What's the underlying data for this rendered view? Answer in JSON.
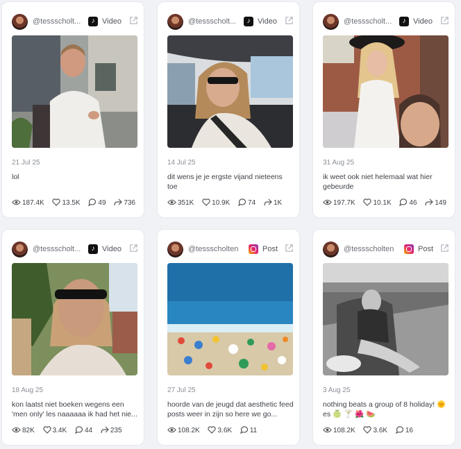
{
  "cards": [
    {
      "handle": "@tessscholt...",
      "platform": "tiktok",
      "type": "Video",
      "date": "21 Jul 25",
      "caption": "lol",
      "views": "187.4K",
      "likes": "13.5K",
      "comments": "49",
      "shares": "736"
    },
    {
      "handle": "@tessscholt...",
      "platform": "tiktok",
      "type": "Video",
      "date": "14 Jul 25",
      "caption": "dit wens je je ergste vijand nieteens toe",
      "views": "351K",
      "likes": "10.9K",
      "comments": "74",
      "shares": "1K"
    },
    {
      "handle": "@tessscholt...",
      "platform": "tiktok",
      "type": "Video",
      "date": "31 Aug 25",
      "caption": "ik weet ook niet helemaal wat hier gebeurde",
      "views": "197.7K",
      "likes": "10.1K",
      "comments": "46",
      "shares": "149"
    },
    {
      "handle": "@tessscholt...",
      "platform": "tiktok",
      "type": "Video",
      "date": "18 Aug 25",
      "caption": "kon laatst niet boeken wegens een 'men only' les naaaaaa ik had het nie...",
      "views": "82K",
      "likes": "3.4K",
      "comments": "44",
      "shares": "235"
    },
    {
      "handle": "@tessscholten",
      "platform": "instagram",
      "type": "Post",
      "date": "27 Jul 25",
      "caption": "hoorde van de jeugd dat aesthetic feed posts weer in zijn so here we go...",
      "views": "108.2K",
      "likes": "3.6K",
      "comments": "11",
      "shares": ""
    },
    {
      "handle": "@tessscholten",
      "platform": "instagram",
      "type": "Post",
      "date": "3 Aug 25",
      "caption": "nothing beats a group of 8 holiday! 🌞 es 🍈 🍸 🌺 🍉",
      "views": "108.2K",
      "likes": "3.6K",
      "comments": "16",
      "shares": ""
    }
  ],
  "colors": {
    "page_bg": "#f1f2f6",
    "card_bg": "#ffffff",
    "tiktok": "#111111",
    "instagram_from": "#f9b100",
    "instagram_to": "#8a3ab9"
  },
  "icons": [
    "eye-icon",
    "heart-icon",
    "comment-icon",
    "share-icon",
    "external-link-icon",
    "tiktok-icon",
    "instagram-icon"
  ]
}
